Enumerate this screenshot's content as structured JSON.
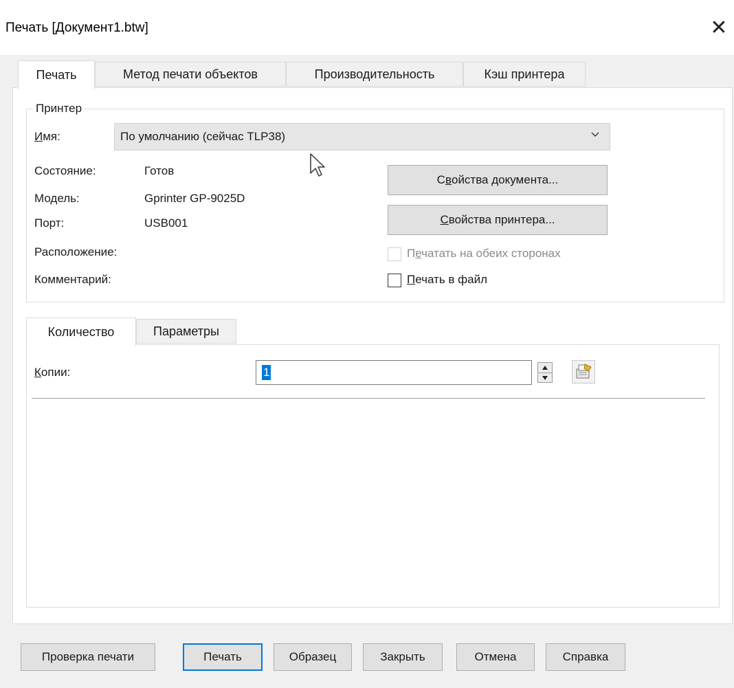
{
  "window": {
    "title": "Печать [Документ1.btw]",
    "close_glyph": "✕"
  },
  "main_tabs": [
    {
      "label": "Печать",
      "active": true
    },
    {
      "label": "Метод печати объектов",
      "active": false
    },
    {
      "label": "Производительность",
      "active": false
    },
    {
      "label": "Кэш принтера",
      "active": false
    }
  ],
  "printer": {
    "group_label": "Принтер",
    "name": {
      "label_first": "И",
      "label_rest": "мя:",
      "value": "По умолчанию (сейчас TLP38)"
    },
    "state": {
      "label": "Состояние:",
      "value": "Готов"
    },
    "model": {
      "label": "Модель:",
      "value": "Gprinter GP-9025D"
    },
    "port": {
      "label": "Порт:",
      "value": "USB001"
    },
    "location": {
      "label": "Расположение:"
    },
    "comment": {
      "label": "Комментарий:"
    },
    "doc_props": {
      "pre": "С",
      "mnemonic": "в",
      "post": "ойства документа..."
    },
    "printer_props": {
      "pre": "",
      "mnemonic": "С",
      "post": "войства принтера..."
    },
    "duplex": {
      "pre": "П",
      "mnemonic": "е",
      "post": "чатать на обеих сторонах",
      "enabled": false,
      "checked": false
    },
    "print_to_file": {
      "pre": "",
      "mnemonic": "П",
      "post": "ечать в файл",
      "checked": false
    }
  },
  "sub_tabs": [
    {
      "label": "Количество",
      "active": true
    },
    {
      "label": "Параметры",
      "active": false
    }
  ],
  "copies": {
    "label_first": "К",
    "label_rest": "опии:",
    "value": "1"
  },
  "buttons": {
    "test_print": "Проверка печати",
    "print": "Печать",
    "preview": "Образец",
    "close": "Закрыть",
    "cancel": "Отмена",
    "help": "Справка"
  },
  "colors": {
    "accent": "#0078d7",
    "panel": "#ffffff",
    "dialog_bg": "#f0f0f0"
  },
  "icons": {
    "dropdown": "chevron-down-icon",
    "cursor": "mouse-pointer-icon",
    "spinner": "spin-up-down-icon",
    "copies_settings": "printer-settings-icon"
  }
}
